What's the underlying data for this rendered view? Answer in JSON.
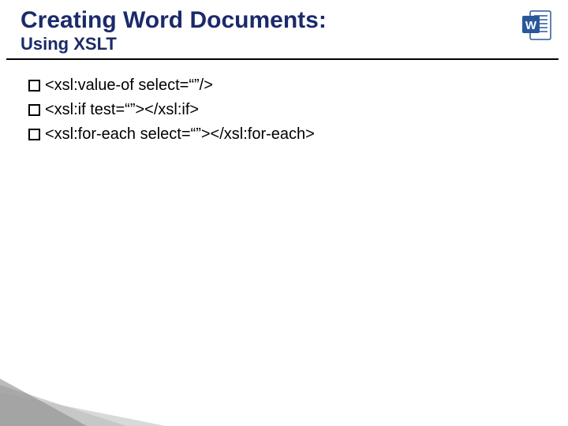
{
  "header": {
    "title": "Creating Word Documents:",
    "subtitle": "Using XSLT"
  },
  "icon": {
    "name": "ms-word"
  },
  "bullets": [
    {
      "text": "<xsl:value-of select=“”/>"
    },
    {
      "text": "<xsl:if test=“”></xsl:if>"
    },
    {
      "text": "<xsl:for-each select=“”></xsl:for-each>"
    }
  ]
}
